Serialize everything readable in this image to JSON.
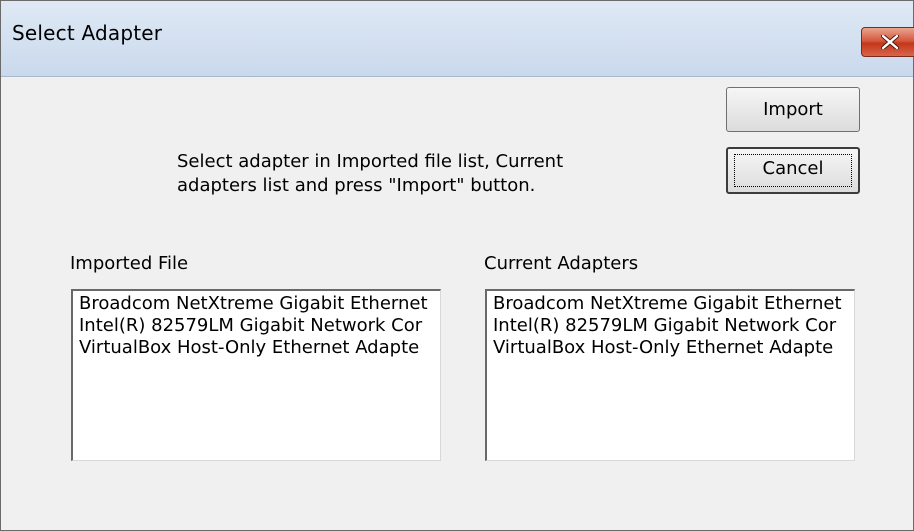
{
  "window": {
    "title": "Select Adapter"
  },
  "buttons": {
    "import_label": "Import",
    "cancel_label": "Cancel"
  },
  "instructions": "Select adapter in Imported file list, Current\nadapters list and press \"Import\" button.",
  "imported_file": {
    "label": "Imported File",
    "items": [
      "Broadcom NetXtreme Gigabit Ethernet",
      "Intel(R) 82579LM Gigabit Network Cor",
      "VirtualBox Host-Only Ethernet Adapte"
    ]
  },
  "current_adapters": {
    "label": "Current Adapters",
    "items": [
      "Broadcom NetXtreme Gigabit Ethernet",
      "Intel(R) 82579LM Gigabit Network Cor",
      "VirtualBox Host-Only Ethernet Adapte"
    ]
  },
  "colors": {
    "close_button": "#d55a3f",
    "titlebar": "#c9d9ec",
    "dialog_bg": "#f0f0f0"
  },
  "icons": {
    "close": "close-icon"
  }
}
